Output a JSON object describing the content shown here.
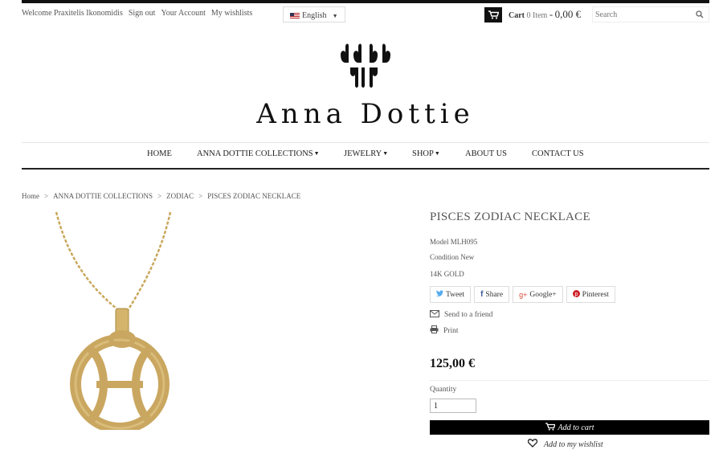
{
  "topbar": {
    "welcome": "Welcome Praxitelis Ikonomidis",
    "sign_out": "Sign out",
    "account": "Your Account",
    "wishlists": "My wishlists",
    "language": "English",
    "cart_label": "Cart",
    "cart_count": "0 Item",
    "cart_dash": "-",
    "cart_total": "0,00 €",
    "search_placeholder": "Search"
  },
  "brand": {
    "name": "Anna Dottie"
  },
  "nav": {
    "items": [
      {
        "label": "HOME",
        "dropdown": false
      },
      {
        "label": "ANNA DOTTIE COLLECTIONS",
        "dropdown": true
      },
      {
        "label": "JEWELRY",
        "dropdown": true
      },
      {
        "label": "SHOP",
        "dropdown": true
      },
      {
        "label": "ABOUT US",
        "dropdown": false
      },
      {
        "label": "CONTACT US",
        "dropdown": false
      }
    ]
  },
  "breadcrumb": {
    "separator": ">",
    "items": [
      "Home",
      "ANNA DOTTIE COLLECTIONS",
      "ZODIAC",
      "PISCES ZODIAC NECKLACE"
    ]
  },
  "product": {
    "title": "PISCES ZODIAC NECKLACE",
    "model": "Model MLH095",
    "condition": "Condition New",
    "material": "14K GOLD",
    "share": {
      "tweet": "Tweet",
      "share": "Share",
      "google": "Google+",
      "pinterest": "Pinterest"
    },
    "send_friend": "Send to a friend",
    "print": "Print",
    "price": "125,00 €",
    "quantity_label": "Quantity",
    "quantity_value": "1",
    "add_to_cart": "Add to cart",
    "add_to_wishlist": "Add to my wishlist"
  },
  "colors": {
    "accent": "#000000",
    "gold": "#c9a85c",
    "twitter": "#55acee",
    "facebook": "#3b5998",
    "google": "#dd4b39",
    "pinterest": "#cb2027"
  }
}
